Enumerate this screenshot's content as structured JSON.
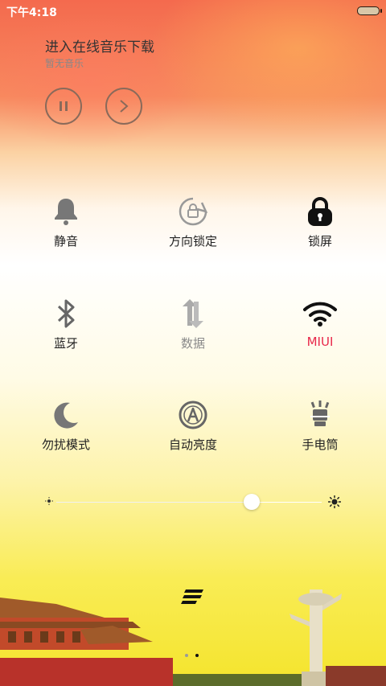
{
  "status": {
    "time": "下午4:18"
  },
  "music": {
    "title": "进入在线音乐下载",
    "subtitle": "暂无音乐"
  },
  "toggles": [
    {
      "label": "静音",
      "icon": "bell-icon"
    },
    {
      "label": "方向锁定",
      "icon": "rotation-lock-icon"
    },
    {
      "label": "锁屏",
      "icon": "lock-icon"
    },
    {
      "label": "蓝牙",
      "icon": "bluetooth-icon"
    },
    {
      "label": "数据",
      "icon": "data-sync-icon"
    },
    {
      "label": "MIUI",
      "icon": "wifi-icon"
    },
    {
      "label": "勿扰模式",
      "icon": "moon-icon"
    },
    {
      "label": "自动亮度",
      "icon": "auto-brightness-icon"
    },
    {
      "label": "手电筒",
      "icon": "flashlight-icon"
    }
  ],
  "brightness": {
    "level": 0.74
  },
  "pager": {
    "pages": 2,
    "active": 2
  },
  "colors": {
    "accent_red": "#e8284a",
    "dim_text": "#8a8a8a"
  }
}
